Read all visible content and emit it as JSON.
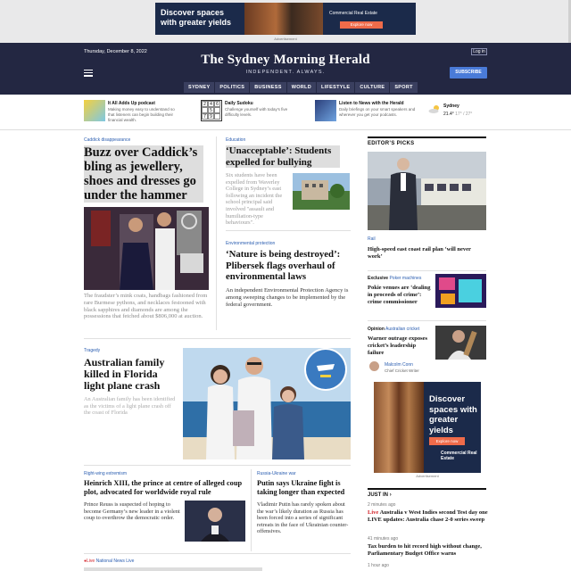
{
  "top_ad": {
    "headline": "Discover spaces with greater yields",
    "brand": "Commercial Real Estate",
    "cta": "Explore now",
    "label": "Advertisement"
  },
  "masthead": {
    "date": "Thursday, December 8, 2022",
    "login": "Log in",
    "logo": "The Sydney Morning Herald",
    "tagline": "INDEPENDENT. ALWAYS.",
    "subscribe": "SUBSCRIBE",
    "nav": [
      "SYDNEY",
      "POLITICS",
      "BUSINESS",
      "WORLD",
      "LIFESTYLE",
      "CULTURE",
      "SPORT"
    ]
  },
  "promo": [
    {
      "title": "It All Adds Up podcast",
      "desc": "Making money easy to understand so that listeners can begin building their financial wealth."
    },
    {
      "title": "Daily Sudoku",
      "desc": "Challenge yourself with today's five difficulty levels."
    },
    {
      "title": "Listen to News with the Herald",
      "desc": "Daily briefings on your smart speakers and wherever you get your podcasts."
    }
  ],
  "sudoku": [
    "2",
    "4",
    "6",
    "",
    "5",
    "",
    "7",
    "9",
    ""
  ],
  "weather": {
    "city": "Sydney",
    "now": "21.4°",
    "range": "17° / 27°"
  },
  "lead": {
    "kicker": "Caddick disappearance",
    "headline": "Buzz over Caddick’s bling as jewellery, shoes and dresses go under the hammer",
    "summary": "The fraudster’s mink coats, handbags fashioned from rare Burmese pythons, and necklaces festooned with black sapphires and diamonds are among the possessions that fetched about $806,000 at auction."
  },
  "education": {
    "kicker": "Education",
    "headline": "‘Unacceptable’: Students expelled for bullying",
    "summary": "Six students have been expelled from Waverley College in Sydney’s east following an incident the school principal said involved \"assault and humiliation-type behaviours\"."
  },
  "environment": {
    "kicker": "Environmental protection",
    "headline": "‘Nature is being destroyed’: Plibersek flags overhaul of environmental laws",
    "summary": "An independent Environmental Protection Agency is among sweeping changes to be implemented by the federal government."
  },
  "tragedy": {
    "kicker": "Tragedy",
    "headline": "Australian family killed in Florida light plane crash",
    "summary": "An Australian family has been identified as the victims of a light plane crash off the coast of Florida"
  },
  "rightwing": {
    "kicker": "Right-wing extremism",
    "headline": "Heinrich XIII, the prince at centre of alleged coup plot, advocated for worldwide royal rule",
    "summary": "Prince Reuss is suspected of hoping to become Germany’s new leader in a violent coup to overthrow the democratic order."
  },
  "ukraine": {
    "kicker": "Russia-Ukraine war",
    "headline": "Putin says Ukraine fight is taking longer than expected",
    "summary": "Vladimir Putin has rarely spoken about the war’s likely duration as Russia has been forced into a series of significant retreats in the face of Ukrainian counter-offensives."
  },
  "live": {
    "tag": "Live",
    "kicker": "National News Live"
  },
  "editors_picks": {
    "title": "EDITOR’S PICKS",
    "items": [
      {
        "kicker": "Rail",
        "headline": "High-speed east coast rail plan ‘will never work’"
      },
      {
        "kicker1": "Exclusive",
        "kicker2": "Poker machines",
        "headline": "Pokie venues are ‘dealing in proceeds of crime’: crime commissioner"
      },
      {
        "kicker1": "Opinion",
        "kicker2": "Australian cricket",
        "headline": "Warner outrage exposes cricket’s leadership failure",
        "author": "Malcolm Conn",
        "role": "Chief Cricket Writer"
      }
    ]
  },
  "side_ad": {
    "headline": "Discover spaces with greater yields",
    "cta": "Explore now",
    "brand": "Commercial Real Estate",
    "label": "Advertisement"
  },
  "just_in": {
    "title": "JUST IN",
    "items": [
      {
        "time": "2 minutes ago",
        "live": "Live",
        "headline": "Australia v West Indies second Test day one LIVE updates: Australia chase 2-0 series sweep"
      },
      {
        "time": "41 minutes ago",
        "headline": "Tax burden to hit record high without change, Parliamentary Budget Office warns"
      },
      {
        "time": "1 hour ago"
      }
    ]
  }
}
